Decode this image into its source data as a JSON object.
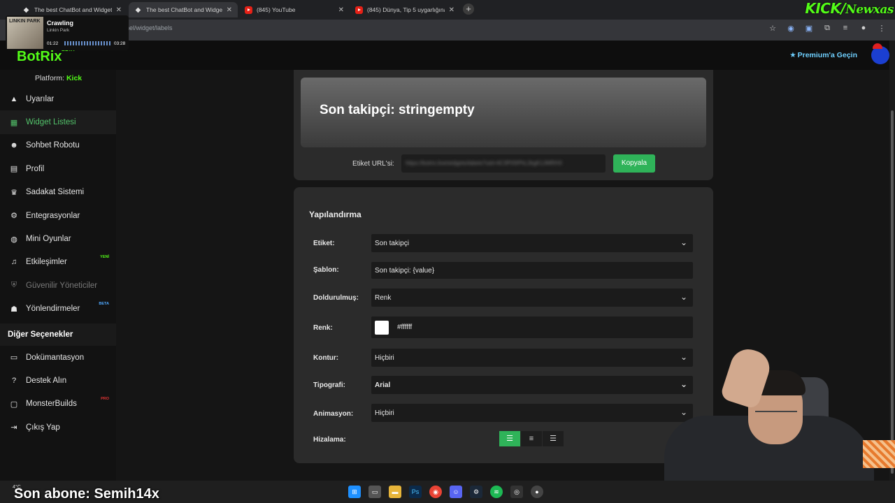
{
  "browser": {
    "tabs": [
      {
        "title": "The best ChatBot and Widgets",
        "icon": "botrix-icon"
      },
      {
        "title": "The best ChatBot and Widgets",
        "icon": "botrix-icon"
      },
      {
        "title": "(845) YouTube",
        "icon": "youtube-icon"
      },
      {
        "title": "(845) Dünya, Tip 5 uygarlığına ulaş",
        "icon": "youtube-icon"
      }
    ],
    "url": "nel/widget/labels"
  },
  "overlay": {
    "kick": "KICK/",
    "newxas": "Newxas",
    "music": {
      "album": "LINKIN PARK",
      "song": "Crawling",
      "artist": "Linkin Park",
      "current": "01:22",
      "total": "03:28"
    },
    "subscriber": "Son abone: Semih14x",
    "weather": "4°C"
  },
  "header": {
    "logo": "BotRix",
    "beta": "BETA",
    "premium": "Premium'a Geçin"
  },
  "sidebar": {
    "platform_label": "Platform:",
    "platform_value": "Kick",
    "items": [
      {
        "label": "Uyarılar",
        "icon": "warning-icon"
      },
      {
        "label": "Widget Listesi",
        "icon": "grid-icon"
      },
      {
        "label": "Sohbet Robotu",
        "icon": "robot-icon"
      },
      {
        "label": "Profil",
        "icon": "id-card-icon"
      },
      {
        "label": "Sadakat Sistemi",
        "icon": "trophy-icon"
      },
      {
        "label": "Entegrasyonlar",
        "icon": "plug-icon"
      },
      {
        "label": "Mini Oyunlar",
        "icon": "gamepad-icon"
      },
      {
        "label": "Etkileşimler",
        "icon": "music-icon",
        "badge": "YENİ"
      },
      {
        "label": "Güvenilir Yöneticiler",
        "icon": "shield-icon"
      },
      {
        "label": "Yönlendirmeler",
        "icon": "users-icon",
        "badge": "BETA"
      }
    ],
    "other_section": "Diğer Seçenekler",
    "other_items": [
      {
        "label": "Dokümantasyon",
        "icon": "scroll-icon"
      },
      {
        "label": "Destek Alın",
        "icon": "question-icon"
      },
      {
        "label": "MonsterBuilds",
        "icon": "laptop-icon",
        "badge": "PRO"
      },
      {
        "label": "Çıkış Yap",
        "icon": "logout-icon"
      }
    ]
  },
  "preview": {
    "text": "Son takipçi: stringempty",
    "url_label": "Etiket URL'si:",
    "url_value": "https://botrix.live/widgets/labels?uid=4C3P0SPhL2kgK1JMRHX",
    "copy_button": "Kopyala"
  },
  "config": {
    "title": "Yapılandırma",
    "fields": {
      "etiket": {
        "label": "Etiket:",
        "value": "Son takipçi"
      },
      "sablon": {
        "label": "Şablon:",
        "value": "Son takipçi: {value}"
      },
      "doldurulmus": {
        "label": "Doldurulmuş:",
        "value": "Renk"
      },
      "renk": {
        "label": "Renk:",
        "value": "#ffffff"
      },
      "kontur": {
        "label": "Kontur:",
        "value": "Hiçbiri"
      },
      "tipografi": {
        "label": "Tipografi:",
        "value": "Arial"
      },
      "animasyon": {
        "label": "Animasyon:",
        "value": "Hiçbiri"
      },
      "hizalama": {
        "label": "Hizalama:",
        "selected": "left"
      }
    }
  },
  "colors": {
    "accent": "#53fc18",
    "button": "#2fb359",
    "active_nav": "#53c46b"
  }
}
